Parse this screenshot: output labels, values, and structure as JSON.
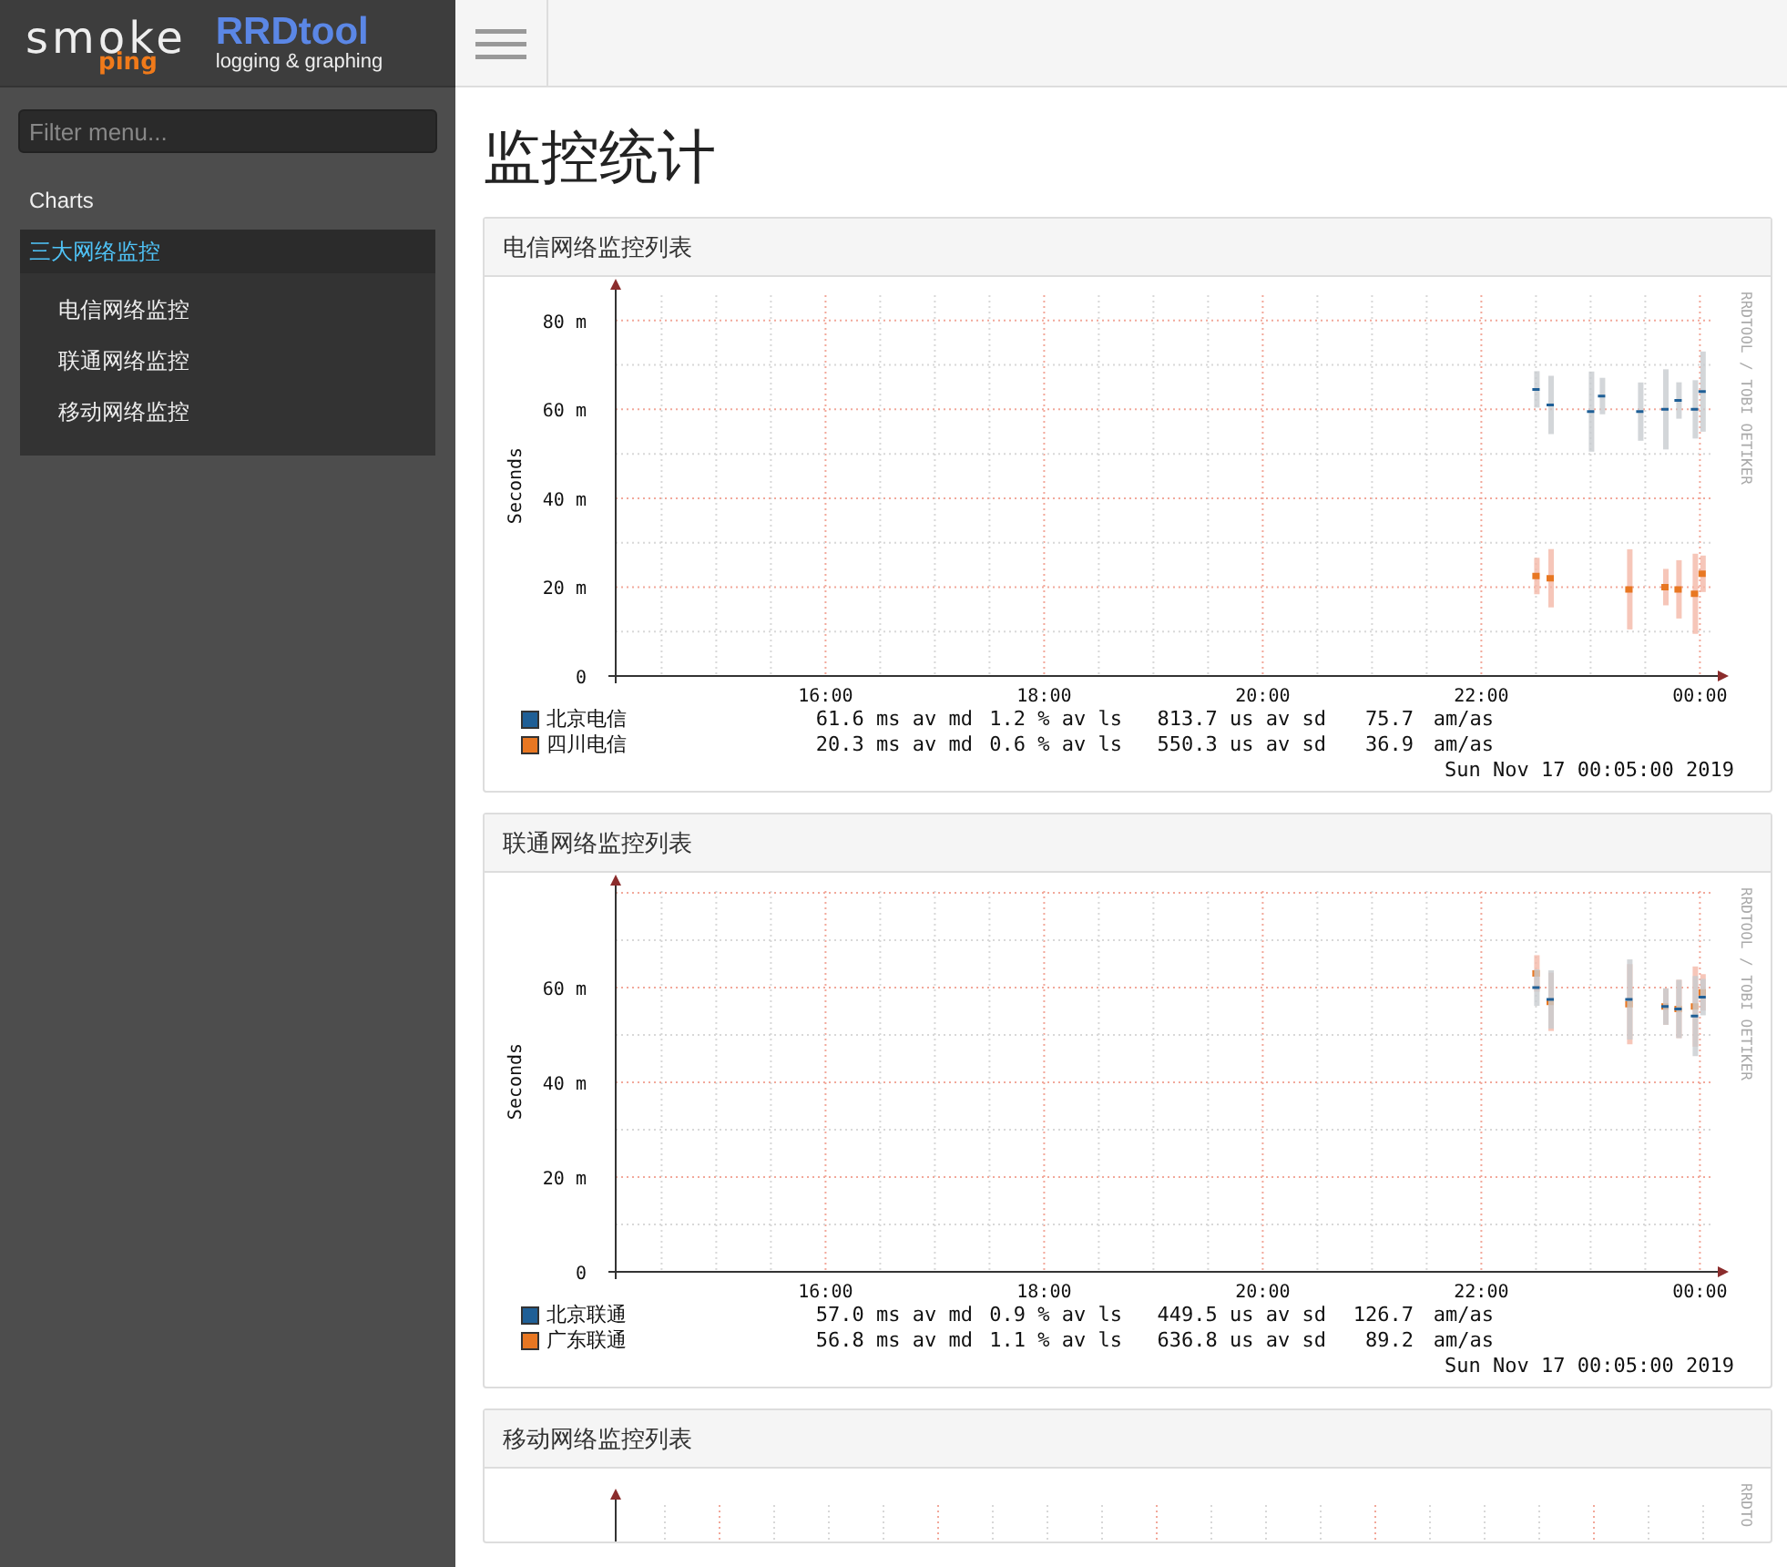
{
  "logo": {
    "smoke": "smoke",
    "ping": "ping",
    "rrd": "RRDtool",
    "rrd_tagline": "logging & graphing"
  },
  "sidebar": {
    "filter": {
      "placeholder": "Filter menu..."
    },
    "items": [
      {
        "label": "Charts",
        "selected": false
      },
      {
        "label": "三大网络监控",
        "selected": true,
        "expanded": true,
        "children": [
          {
            "label": "电信网络监控",
            "selected": false
          },
          {
            "label": "联通网络监控",
            "selected": false
          },
          {
            "label": "移动网络监控",
            "selected": false
          }
        ]
      }
    ]
  },
  "page_title": "监控统计",
  "panels": [
    {
      "title": "电信网络监控列表",
      "kind": "graph",
      "credit": "RRDTOOL / TOBI OETIKER",
      "date": "Sun Nov 17 00:05:00 2019",
      "legend": [
        {
          "median": "61.6 ms av md",
          "loss": "1.2 % av ls",
          "sd": "813.7 us av sd",
          "ratio": "75.7",
          "unit": "am/as"
        },
        {
          "median": "20.3 ms av md",
          "loss": "0.6 % av ls",
          "sd": "550.3 us av sd",
          "ratio": "36.9",
          "unit": "am/as"
        }
      ],
      "chart_data": {
        "type": "line",
        "grid": true,
        "ylabel": "Seconds",
        "x": [
          22.5,
          22.63,
          23.0,
          23.1,
          23.35,
          23.45,
          23.68,
          23.8,
          23.95,
          24.02
        ],
        "xlim": [
          14.08,
          24.13
        ],
        "ylim": [
          0,
          85.7
        ],
        "xticks": [
          {
            "value": 16,
            "label": "16:00"
          },
          {
            "value": 18,
            "label": "18:00"
          },
          {
            "value": 20,
            "label": "20:00"
          },
          {
            "value": 22,
            "label": "22:00"
          },
          {
            "value": 24,
            "label": "00:00"
          }
        ],
        "yticks": [
          {
            "value": 0,
            "label": "0"
          },
          {
            "value": 20,
            "label": "20 m"
          },
          {
            "value": 40,
            "label": "40 m"
          },
          {
            "value": 60,
            "label": "60 m"
          },
          {
            "value": 80,
            "label": "80 m"
          }
        ],
        "series": [
          {
            "name": "北京电信",
            "color": "#1f5f96",
            "values": [
              64.5,
              61,
              59.5,
              63,
              null,
              59.5,
              60,
              62,
              60,
              64
            ]
          },
          {
            "name": "四川电信",
            "color": "#e87722",
            "values": [
              22.5,
              22,
              null,
              null,
              19.5,
              null,
              20,
              19.5,
              18.5,
              23
            ]
          }
        ]
      }
    },
    {
      "title": "联通网络监控列表",
      "kind": "graph",
      "credit": "RRDTOOL / TOBI OETIKER",
      "date": "Sun Nov 17 00:05:00 2019",
      "legend": [
        {
          "median": "57.0 ms av md",
          "loss": "0.9 % av ls",
          "sd": "449.5 us av sd",
          "ratio": "126.7",
          "unit": "am/as"
        },
        {
          "median": "56.8 ms av md",
          "loss": "1.1 % av ls",
          "sd": "636.8 us av sd",
          "ratio": "89.2",
          "unit": "am/as"
        }
      ],
      "chart_data": {
        "type": "line",
        "grid": true,
        "ylabel": "Seconds",
        "x": [
          22.5,
          22.63,
          23.35,
          23.68,
          23.8,
          23.95,
          24.02
        ],
        "xlim": [
          14.08,
          24.13
        ],
        "ylim": [
          0,
          80.4
        ],
        "xticks": [
          {
            "value": 16,
            "label": "16:00"
          },
          {
            "value": 18,
            "label": "18:00"
          },
          {
            "value": 20,
            "label": "20:00"
          },
          {
            "value": 22,
            "label": "22:00"
          },
          {
            "value": 24,
            "label": "00:00"
          }
        ],
        "yticks": [
          {
            "value": 0,
            "label": "0"
          },
          {
            "value": 20,
            "label": "20 m"
          },
          {
            "value": 40,
            "label": "40 m"
          },
          {
            "value": 60,
            "label": "60 m"
          }
        ],
        "series": [
          {
            "name": "北京联通",
            "color": "#1f5f96",
            "values": [
              60,
              57.5,
              57.5,
              56,
              55.5,
              54,
              58
            ]
          },
          {
            "name": "广东联通",
            "color": "#e87722",
            "values": [
              63,
              57,
              56.5,
              56,
              55.5,
              56,
              59
            ]
          }
        ]
      }
    },
    {
      "title": "移动网络监控列表",
      "kind": "graph_top",
      "credit": "RRDTO"
    }
  ]
}
